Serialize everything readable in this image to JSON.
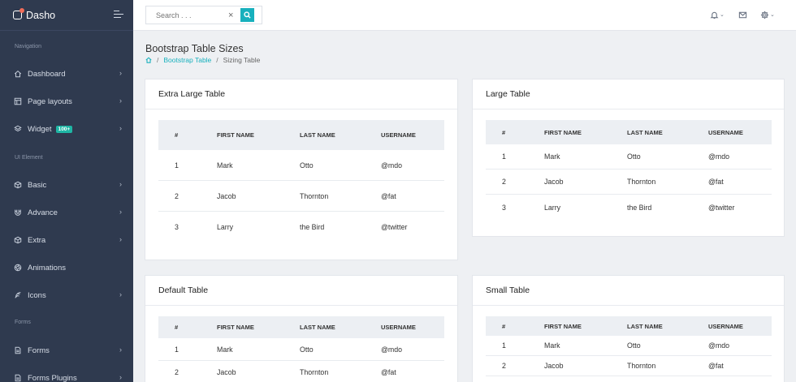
{
  "brand": {
    "name": "Dasho"
  },
  "sidebar": {
    "headers": [
      "Navigation",
      "UI Element",
      "Forms"
    ],
    "items": [
      {
        "label": "Dashboard",
        "icon": "home-icon"
      },
      {
        "label": "Page layouts",
        "icon": "layout-icon"
      },
      {
        "label": "Widget",
        "icon": "layers-icon",
        "badge": "100+"
      },
      {
        "label": "Basic",
        "icon": "box-icon"
      },
      {
        "label": "Advance",
        "icon": "magnet-icon"
      },
      {
        "label": "Extra",
        "icon": "box-icon"
      },
      {
        "label": "Animations",
        "icon": "aperture-icon"
      },
      {
        "label": "Icons",
        "icon": "feather-icon"
      },
      {
        "label": "Forms",
        "icon": "file-icon"
      },
      {
        "label": "Forms Plugins",
        "icon": "file-icon"
      }
    ]
  },
  "topbar": {
    "search_placeholder": "Search . . .",
    "clear_glyph": "×"
  },
  "page": {
    "title": "Bootstrap Table Sizes",
    "breadcrumb": [
      "Bootstrap Table",
      "Sizing Table"
    ]
  },
  "columns": [
    "#",
    "FIRST NAME",
    "LAST NAME",
    "USERNAME"
  ],
  "cards": [
    {
      "title": "Extra Large Table",
      "rows": [
        [
          "1",
          "Mark",
          "Otto",
          "@mdo"
        ],
        [
          "2",
          "Jacob",
          "Thornton",
          "@fat"
        ],
        [
          "3",
          "Larry",
          "the Bird",
          "@twitter"
        ]
      ]
    },
    {
      "title": "Large Table",
      "rows": [
        [
          "1",
          "Mark",
          "Otto",
          "@mdo"
        ],
        [
          "2",
          "Jacob",
          "Thornton",
          "@fat"
        ],
        [
          "3",
          "Larry",
          "the Bird",
          "@twitter"
        ]
      ]
    },
    {
      "title": "Default Table",
      "rows": [
        [
          "1",
          "Mark",
          "Otto",
          "@mdo"
        ],
        [
          "2",
          "Jacob",
          "Thornton",
          "@fat"
        ]
      ]
    },
    {
      "title": "Small Table",
      "rows": [
        [
          "1",
          "Mark",
          "Otto",
          "@mdo"
        ],
        [
          "2",
          "Jacob",
          "Thornton",
          "@fat"
        ]
      ]
    }
  ],
  "colors": {
    "sidebar": "#2f3a4f",
    "accent": "#17b0bd",
    "badge": "#1fb6a5"
  }
}
